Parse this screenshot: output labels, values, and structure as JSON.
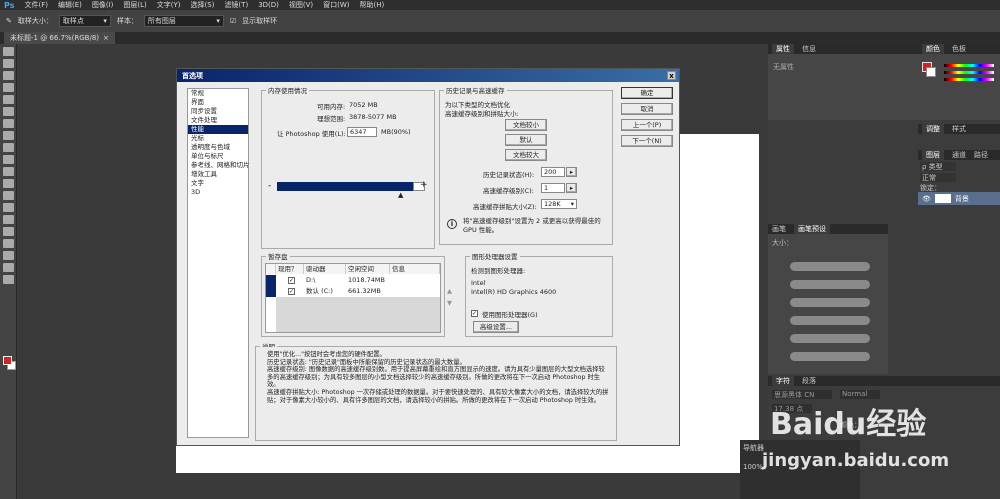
{
  "app": {
    "logo": "Ps"
  },
  "menu": [
    "文件(F)",
    "编辑(E)",
    "图像(I)",
    "图层(L)",
    "文字(Y)",
    "选择(S)",
    "滤镜(T)",
    "3D(D)",
    "视图(V)",
    "窗口(W)",
    "帮助(H)"
  ],
  "options": {
    "sample_size_label": "取样大小：",
    "sample_size_value": "取样点",
    "sample_label": "样本：",
    "sample_value": "所有图层",
    "show_ring_label": "显示取样环"
  },
  "document": {
    "tab": "未标题-1 @ 66.7%(RGB/8)"
  },
  "panels": {
    "top_tabs": [
      "属性",
      "信息"
    ],
    "attr_empty": "无属性",
    "color_tabs": [
      "颜色",
      "色板"
    ],
    "adjust_tabs": [
      "调整",
      "样式"
    ],
    "layers_tabs": [
      "图层",
      "通道",
      "路径"
    ],
    "layers_kind": "ρ 类型",
    "blend_mode": "正常",
    "lock_label": "锁定：",
    "layer_name": "背景",
    "brush_tabs": [
      "画笔",
      "画笔预设"
    ],
    "brush_size_label": "大小：",
    "char_tabs": [
      "字符",
      "段落"
    ],
    "font_name": "思源黑体 CN",
    "font_style": "Normal",
    "font_size": "17.38 点",
    "color_label": "颜色：",
    "nav_title": "导航器",
    "zoom": "100%"
  },
  "dialog": {
    "title": "首选项",
    "close": "x",
    "categories": [
      "常规",
      "界面",
      "同步设置",
      "文件处理",
      "性能",
      "光标",
      "透明度与色域",
      "单位与标尺",
      "参考线、网格和切片",
      "增效工具",
      "文字",
      "3D"
    ],
    "selected_index": 4,
    "buttons": {
      "ok": "确定",
      "cancel": "取消",
      "prev": "上一个(P)",
      "next": "下一个(N)"
    },
    "memory": {
      "legend": "内存使用情况",
      "available_label": "可用内存:",
      "available_value": "7052 MB",
      "ideal_label": "理想范围:",
      "ideal_value": "3878-5077 MB",
      "use_label": "让 Photoshop 使用(L):",
      "use_value": "6347",
      "use_unit": "MB(90%)",
      "minus": "-",
      "plus": "+",
      "fill_fraction": 0.9
    },
    "history": {
      "legend": "历史记录与高速缓存",
      "desc1": "为以下类型的文档优化",
      "desc2": "高速缓存级别和拼贴大小:",
      "btn_small": "文档较小",
      "btn_default": "默认",
      "btn_large": "文档较大",
      "states_label": "历史记录状态(H):",
      "states_value": "200",
      "levels_label": "高速缓存级别(C):",
      "levels_value": "1",
      "tile_label": "高速缓存拼贴大小(Z):",
      "tile_value": "128K",
      "info_line1": "将\"高速缓存级别\"设置为 2 或更高以获得最佳的",
      "info_line2": "GPU 性能。"
    },
    "scratch": {
      "legend": "暂存盘",
      "headers": [
        "现用？",
        "驱动器",
        "空闲空间",
        "信息"
      ],
      "rows": [
        {
          "drive": "D:\\",
          "free": "1018.74MB"
        },
        {
          "drive": "数认 (C:)",
          "free": "661.32MB"
        }
      ]
    },
    "gpu": {
      "legend": "图形处理器设置",
      "detected_label": "检测到图形处理器:",
      "vendor": "Intel",
      "model": "Intel(R) HD Graphics 4600",
      "use_gpu_label": "使用图形处理器(G)",
      "advanced_btn": "高级设置..."
    },
    "description": {
      "legend": "说明",
      "lines": [
        "使用\"优化...\"按钮时会考虑您的硬件配置。",
        "历史记录状态: \"历史记录\"面板中所能保留的历史记录状态的最大数量。",
        "高速缓存级别: 图像数据的高速缓存级别数。用于提高屏幕重绘和直方图显示的速度。请为具有少量图层的大型文档选择较多的高速缓存级别；为具有较多图层的小型文档选择较少的高速缓存级别。所做的更改将在下一次启动 Photoshop 时生效。",
        "高速缓存拼贴大小: Photoshop 一次存储或处理的数据量。对于要快速处理的、具有较大像素大小的文档，请选择较大的拼贴；对于像素大小较小的、具有许多图层的文档，请选择较小的拼贴。所做的更改将在下一次启动 Photoshop 时生效。"
      ]
    }
  },
  "watermark": {
    "line1": "Baidu经验",
    "line2": "jingyan.baidu.com"
  }
}
